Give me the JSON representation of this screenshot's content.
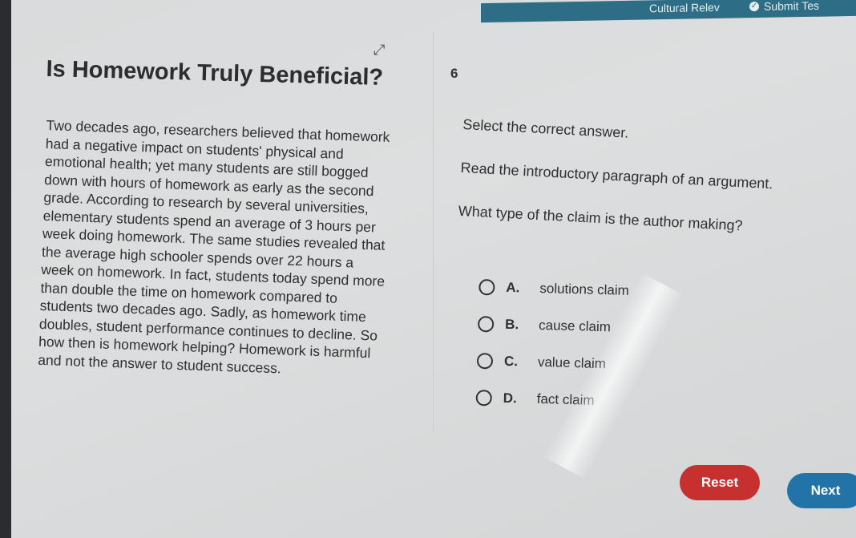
{
  "topbar": {
    "tab_name": "Cultural Relev",
    "submit_label": "Submit Tes"
  },
  "article": {
    "title": "Is Homework Truly Beneficial?",
    "paragraph": "Two decades ago, researchers believed that homework had a negative impact on students' physical and emotional health; yet many students are still bogged down with hours of homework as early as the second grade. According to research by several universities, elementary students spend an average of 3 hours per week doing homework. The same studies revealed that the average high schooler spends over 22 hours a week on homework. In fact, students today spend more than double the time on homework compared to students two decades ago. Sadly, as homework time doubles, student performance continues to decline. So how then is homework helping? Homework is harmful and not the answer to student success."
  },
  "question": {
    "number": "6",
    "instruction": "Select the correct answer.",
    "prompt_line1": "Read the introductory paragraph of an argument.",
    "prompt_line2": "What type of the claim is the author making?",
    "options": [
      {
        "letter": "A.",
        "text": "solutions claim"
      },
      {
        "letter": "B.",
        "text": "cause claim"
      },
      {
        "letter": "C.",
        "text": "value claim"
      },
      {
        "letter": "D.",
        "text": "fact claim"
      }
    ]
  },
  "buttons": {
    "reset": "Reset",
    "next": "Next"
  },
  "colors": {
    "reset": "#c6302f",
    "next": "#2273a8",
    "topbar": "#2d6d86"
  }
}
